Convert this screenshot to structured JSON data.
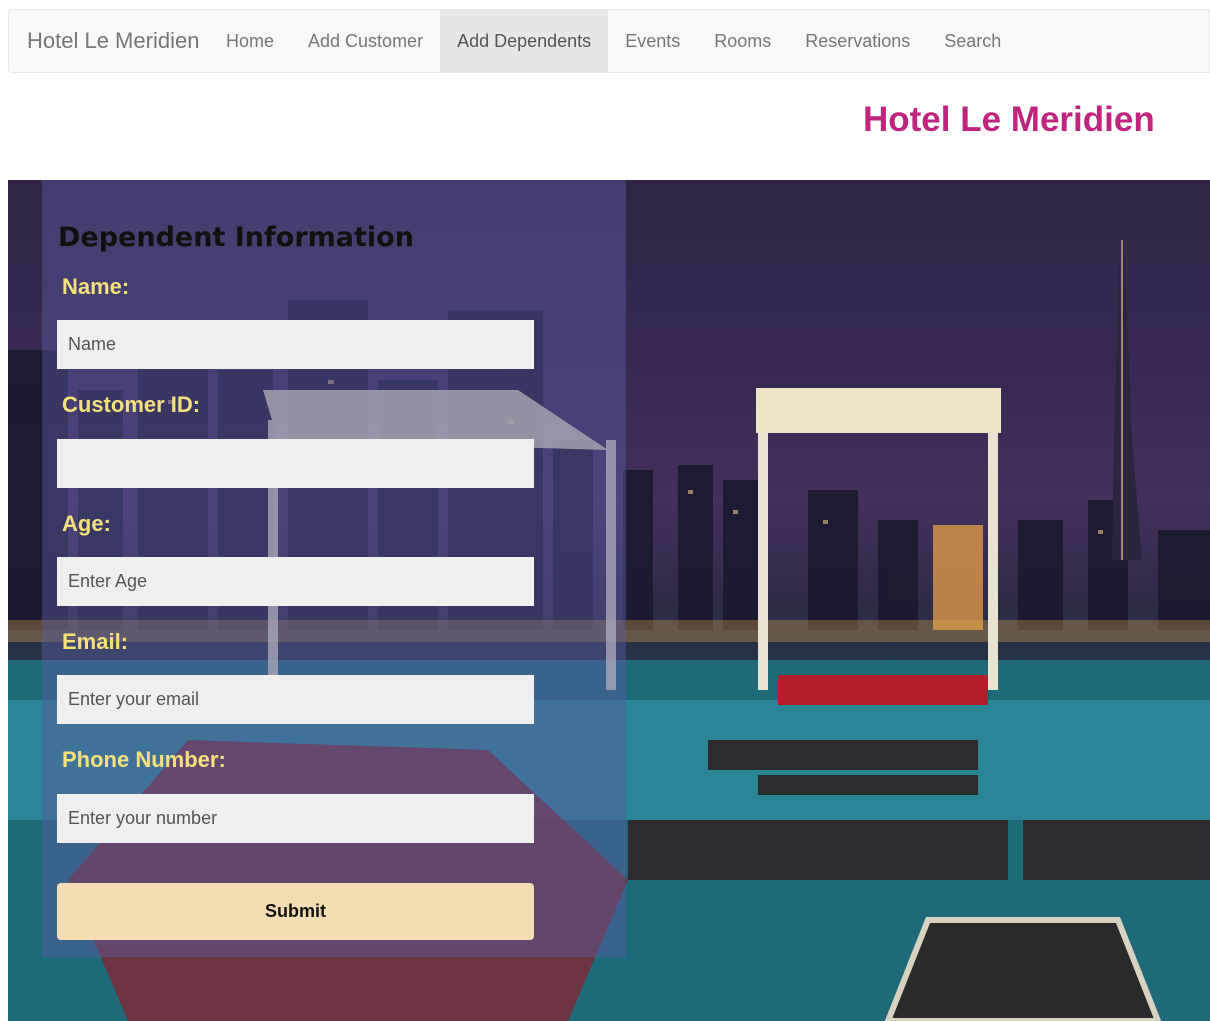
{
  "navbar": {
    "brand": "Hotel Le Meridien",
    "items": [
      {
        "label": "Home",
        "active": false
      },
      {
        "label": "Add Customer",
        "active": false
      },
      {
        "label": "Add Dependents",
        "active": true
      },
      {
        "label": "Events",
        "active": false
      },
      {
        "label": "Rooms",
        "active": false
      },
      {
        "label": "Reservations",
        "active": false
      },
      {
        "label": "Search",
        "active": false
      }
    ]
  },
  "page": {
    "heading": "Hotel Le Meridien"
  },
  "form": {
    "title": "Dependent Information",
    "name": {
      "label": "Name:",
      "placeholder": "Name",
      "value": ""
    },
    "customer_id": {
      "label": "Customer ID:",
      "placeholder": "",
      "value": ""
    },
    "age": {
      "label": "Age:",
      "placeholder": "Enter Age",
      "value": ""
    },
    "email": {
      "label": "Email:",
      "placeholder": "Enter your email",
      "value": ""
    },
    "phone": {
      "label": "Phone Number:",
      "placeholder": "Enter your number",
      "value": ""
    },
    "submit_label": "Submit"
  },
  "colors": {
    "heading": "#c0247f",
    "label": "#f5e17a",
    "submit": "#f6dcb2",
    "active_nav": "#e7e7e7"
  }
}
